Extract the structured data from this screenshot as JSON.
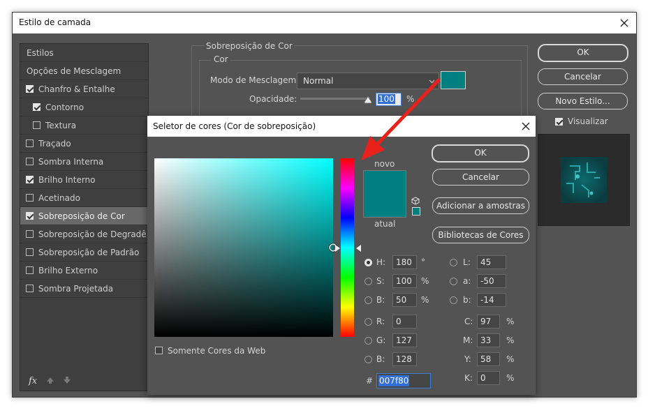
{
  "window": {
    "title": "Estilo de camada"
  },
  "sidebar": {
    "items": [
      {
        "label": "Estilos",
        "checkbox": null,
        "selected": false
      },
      {
        "label": "Opções de Mesclagem",
        "checkbox": null,
        "selected": false
      },
      {
        "label": "Chanfro & Entalhe",
        "checkbox": true,
        "selected": false
      },
      {
        "label": "Contorno",
        "checkbox": true,
        "selected": false,
        "indent": true
      },
      {
        "label": "Textura",
        "checkbox": false,
        "selected": false,
        "indent": true
      },
      {
        "label": "Traçado",
        "checkbox": false,
        "selected": false
      },
      {
        "label": "Sombra Interna",
        "checkbox": false,
        "selected": false
      },
      {
        "label": "Brilho Interno",
        "checkbox": true,
        "selected": false
      },
      {
        "label": "Acetinado",
        "checkbox": false,
        "selected": false
      },
      {
        "label": "Sobreposição de Cor",
        "checkbox": true,
        "selected": true
      },
      {
        "label": "Sobreposição de Degradê",
        "checkbox": false,
        "selected": false
      },
      {
        "label": "Sobreposição de Padrão",
        "checkbox": false,
        "selected": false
      },
      {
        "label": "Brilho Externo",
        "checkbox": false,
        "selected": false
      },
      {
        "label": "Sombra Projetada",
        "checkbox": false,
        "selected": false
      }
    ],
    "fx_label": "fx"
  },
  "overlay": {
    "section_title": "Sobreposição de Cor",
    "group_title": "Cor",
    "blend_label": "Modo de Mesclagem:",
    "blend_value": "Normal",
    "opacity_label": "Opacidade:",
    "opacity_value": "100",
    "opacity_unit": "%",
    "swatch_color": "#007f80"
  },
  "dialog_buttons": {
    "ok": "OK",
    "cancel": "Cancelar",
    "new_style": "Novo Estilo...",
    "preview_label": "Visualizar",
    "preview_checked": true
  },
  "picker": {
    "title": "Seletor de cores (Cor de sobreposição)",
    "ok": "OK",
    "cancel": "Cancelar",
    "add_swatches": "Adicionar a amostras",
    "color_libraries": "Bibliotecas de Cores",
    "new_label": "novo",
    "current_label": "atual",
    "new_color": "#007f80",
    "current_color": "#007f80",
    "web_only_label": "Somente Cores da Web",
    "hue_color": "#00ffff",
    "fields": {
      "H": {
        "label": "H:",
        "value": "180",
        "unit": "°"
      },
      "S": {
        "label": "S:",
        "value": "100",
        "unit": "%"
      },
      "Bv": {
        "label": "B:",
        "value": "50",
        "unit": "%"
      },
      "R": {
        "label": "R:",
        "value": "0"
      },
      "G": {
        "label": "G:",
        "value": "127"
      },
      "Bc": {
        "label": "B:",
        "value": "128"
      },
      "L": {
        "label": "L:",
        "value": "45"
      },
      "a": {
        "label": "a:",
        "value": "-50"
      },
      "b": {
        "label": "b:",
        "value": "-14"
      },
      "C": {
        "label": "C:",
        "value": "97",
        "unit": "%"
      },
      "M": {
        "label": "M:",
        "value": "33",
        "unit": "%"
      },
      "Y": {
        "label": "Y:",
        "value": "58",
        "unit": "%"
      },
      "K": {
        "label": "K:",
        "value": "0",
        "unit": "%"
      },
      "hex_label": "#",
      "hex": "007f80"
    }
  },
  "annotation": {
    "arrow_color": "#e8211b"
  }
}
